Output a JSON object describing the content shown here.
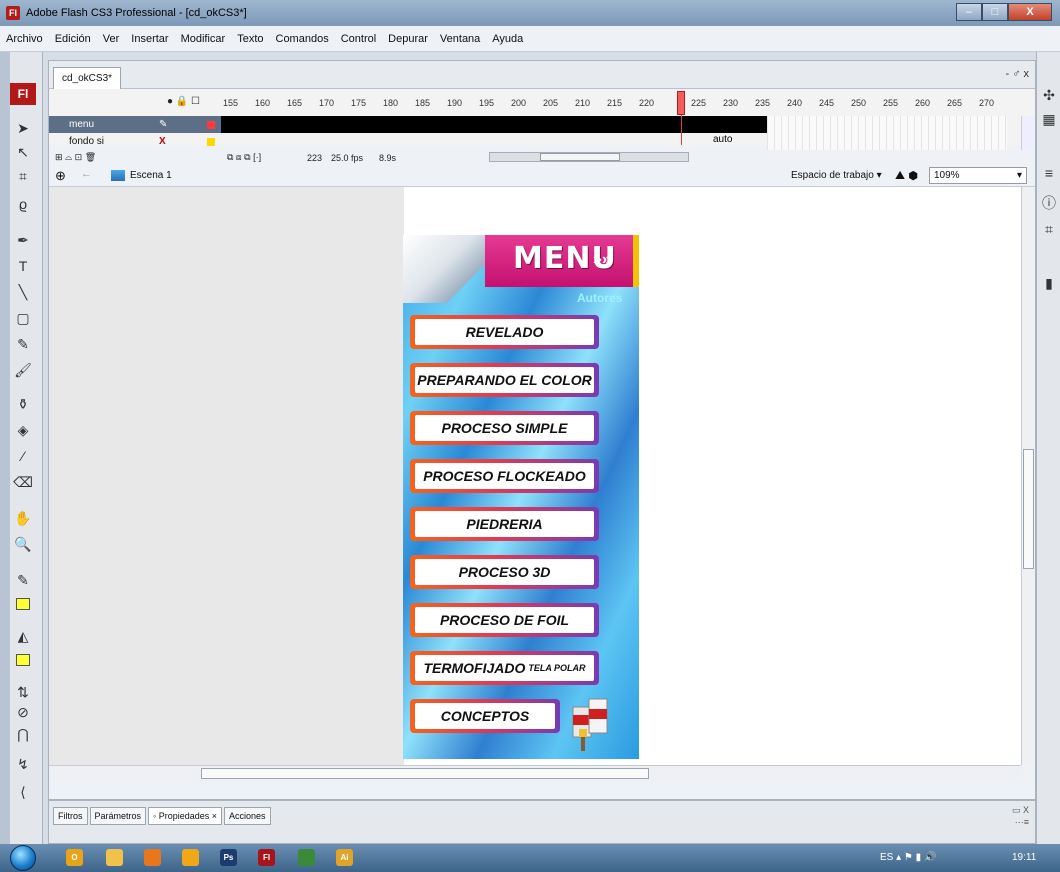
{
  "window": {
    "title": "Adobe Flash CS3 Professional - [cd_okCS3*]",
    "app_icon": "Fl",
    "controls": [
      "minimize",
      "maximize",
      "close"
    ]
  },
  "menubar": {
    "items": [
      "Archivo",
      "Edición",
      "Ver",
      "Insertar",
      "Modificar",
      "Texto",
      "Comandos",
      "Control",
      "Depurar",
      "Ventana",
      "Ayuda"
    ]
  },
  "document": {
    "tab_label": "cd_okCS3*",
    "tab_controls": "- ♂ x"
  },
  "timeline": {
    "ruler": [
      "155",
      "160",
      "165",
      "170",
      "175",
      "180",
      "185",
      "190",
      "195",
      "200",
      "205",
      "210",
      "215",
      "220",
      "225",
      "230",
      "235",
      "240",
      "245",
      "250",
      "255",
      "260",
      "265",
      "270"
    ],
    "layers": [
      {
        "name": "menu",
        "selected": true
      },
      {
        "name": "fondo si",
        "selected": false
      }
    ],
    "frame_label": "auto",
    "current_frame": "223",
    "fps": "25.0 fps",
    "time": "8.9s"
  },
  "editbar": {
    "scene": "Escena 1",
    "workspace": "Espacio de trabajo",
    "zoom": "109%"
  },
  "stage_menu": {
    "title": "MENU",
    "arrows": "»»",
    "authors": "Autores",
    "buttons": [
      {
        "label": "REVELADO",
        "extra": ""
      },
      {
        "label": "PREPARANDO EL COLOR",
        "extra": ""
      },
      {
        "label": "PROCESO SIMPLE",
        "extra": ""
      },
      {
        "label": "PROCESO FLOCKEADO",
        "extra": ""
      },
      {
        "label": "PIEDRERIA",
        "extra": ""
      },
      {
        "label": "PROCESO 3D",
        "extra": ""
      },
      {
        "label": "PROCESO DE FOIL",
        "extra": ""
      },
      {
        "label": "TERMOFIJADO",
        "extra": "TELA POLAR"
      },
      {
        "label": "CONCEPTOS",
        "extra": ""
      }
    ]
  },
  "properties": {
    "tabs": [
      "Filtros",
      "Parámetros",
      "◦ Propiedades ×",
      "Acciones"
    ]
  },
  "taskbar": {
    "apps": [
      {
        "icon": "outlook-icon",
        "label": "O",
        "color": "#e8a317"
      },
      {
        "icon": "explorer-icon",
        "label": "",
        "color": "#f1c24b"
      },
      {
        "icon": "firefox-icon",
        "label": "",
        "color": "#e8761c"
      },
      {
        "icon": "media-icon",
        "label": "",
        "color": "#f0a818"
      },
      {
        "icon": "photoshop-icon",
        "label": "Ps",
        "color": "#1c3b6e"
      },
      {
        "icon": "flash-icon",
        "label": "Fl",
        "color": "#a6151b"
      },
      {
        "icon": "dreamweaver-icon",
        "label": "",
        "color": "#3a8a3a"
      },
      {
        "icon": "illustrator-icon",
        "label": "Ai",
        "color": "#e0a42a"
      }
    ],
    "language": "ES",
    "clock": "19:11"
  }
}
